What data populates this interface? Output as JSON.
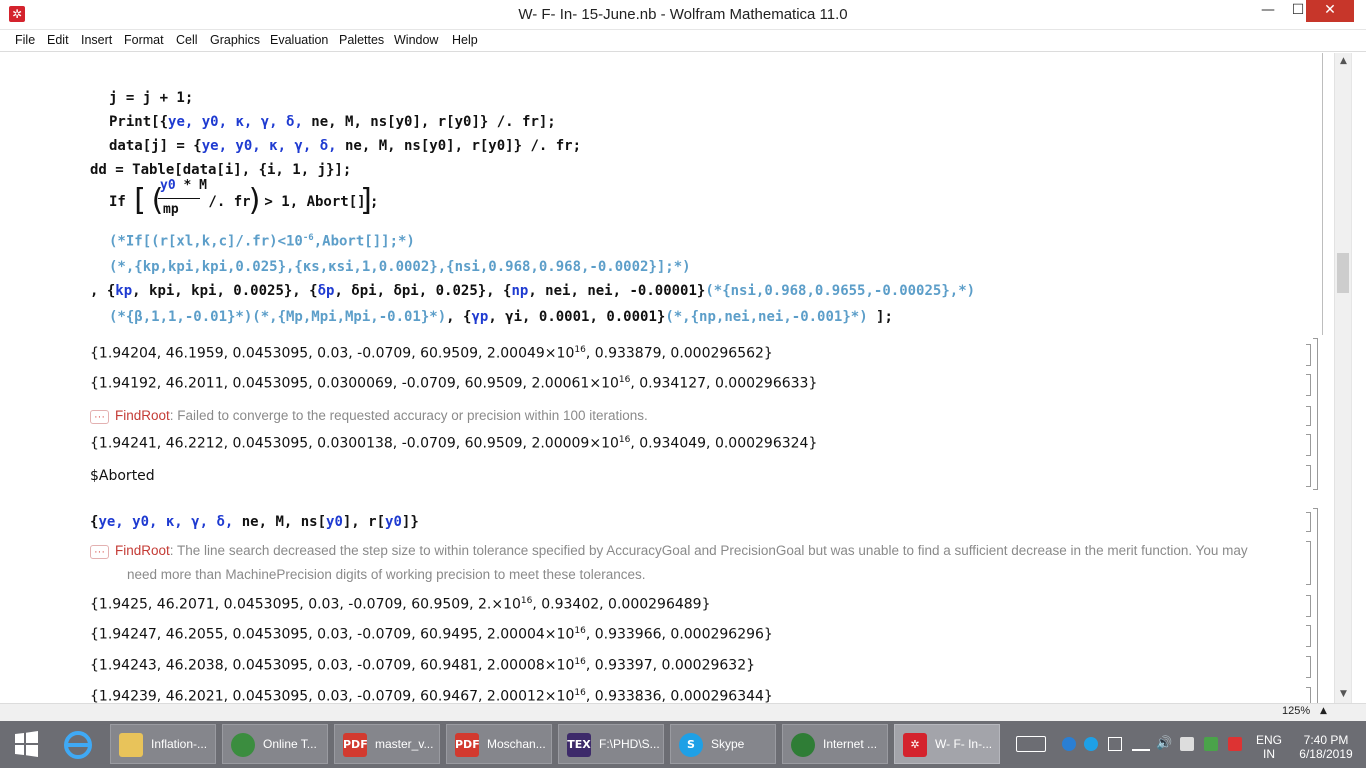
{
  "window": {
    "title": "W- F- In- 15-June.nb - Wolfram Mathematica 11.0",
    "minimize": "—",
    "maximize": "☐",
    "close": "✕"
  },
  "menu": [
    "File",
    "Edit",
    "Insert",
    "Format",
    "Cell",
    "Graphics",
    "Evaluation",
    "Palettes",
    "Window",
    "Help"
  ],
  "code": {
    "line1": "j = j + 1;",
    "line2_a": "Print[{",
    "line2_b": "ye, y0, κ, γ, δ,",
    "line2_c": " ne, M, ns[y0], r[y0]} /. fr];",
    "line3_a": "data[j] = {",
    "line3_b": "ye, y0, κ, γ, δ,",
    "line3_c": " ne, M, ns[y0], r[y0]} /. fr;",
    "line4": "dd = Table[data[i], {i, 1, j}];",
    "line5_if": "If",
    "line5_num": "y0 * M",
    "line5_den": "mp",
    "line5_rest": " /. fr",
    "line5_tail": " > 1, Abort[]",
    "line5_end": ";",
    "line6": "(*If[(r[xl,k,c]/.fr)<10",
    "line6_sup": "-6",
    "line6_tail": ",Abort[]];*)",
    "line7": "(*,{kp,kpi,kpi,0.025},{κs,κsi,1,0.0002},{nsi,0.968,0.968,-0.0002}];*)",
    "line8_a": ", {",
    "line8_b": "kp",
    "line8_c": ", kpi, kpi, 0.0025}, {",
    "line8_d": "δp",
    "line8_e": ", δpi, δpi, 0.025}, {",
    "line8_f": "np",
    "line8_g": ", nei, nei, -0.00001}",
    "line8_comment": "(*{nsi,0.968,0.9655,-0.00025},*)",
    "line9_comment": "(*{β,1,1,-0.01}*)(*,{Mp,Mpi,Mpi,-0.01}*)",
    "line9_b": ", {",
    "line9_c": "γp",
    "line9_d": ", γi, 0.0001, 0.0001}",
    "line9_comment2": "(*,{np,nei,nei,-0.001}*)",
    "line9_end": ";"
  },
  "outputs": [
    {
      "pre": "{1.94204, 46.1959, 0.0453095, 0.03, -0.0709, 60.9509, 2.00049×10",
      "sup": "16",
      "post": ", 0.933879, 0.000296562}"
    },
    {
      "pre": "{1.94192, 46.2011, 0.0453095, 0.0300069, -0.0709, 60.9509, 2.00061×10",
      "sup": "16",
      "post": ", 0.934127, 0.000296633}"
    },
    {
      "pre": "{1.94241, 46.2212, 0.0453095, 0.0300138, -0.0709, 60.9509, 2.00009×10",
      "sup": "16",
      "post": ", 0.934049, 0.000296324}"
    },
    {
      "pre": "{1.9425, 46.2071, 0.0453095, 0.03, -0.0709, 60.9509, 2.×10",
      "sup": "16",
      "post": ", 0.93402, 0.000296489}"
    },
    {
      "pre": "{1.94247, 46.2055, 0.0453095, 0.03, -0.0709, 60.9495, 2.00004×10",
      "sup": "16",
      "post": ", 0.933966, 0.000296296}"
    },
    {
      "pre": "{1.94243, 46.2038, 0.0453095, 0.03, -0.0709, 60.9481, 2.00008×10",
      "sup": "16",
      "post": ", 0.93397, 0.00029632}"
    },
    {
      "pre": "{1.94239, 46.2021, 0.0453095, 0.03, -0.0709, 60.9467, 2.00012×10",
      "sup": "16",
      "post": ", 0.933836, 0.000296344}"
    }
  ],
  "messages": {
    "dots": "···",
    "msg1_name": "FindRoot",
    "msg1_text": ": Failed to converge to the requested accuracy or precision within 100 iterations.",
    "msg2_name": "FindRoot",
    "msg2_text": ": The line search decreased the step size to within tolerance specified by AccuracyGoal and PrecisionGoal but was unable to find a sufficient decrease in the merit function. You may",
    "msg2_text2": "need more than MachinePrecision digits of working precision to meet these tolerances."
  },
  "aborted": "$Aborted",
  "input2": "{ye, y0, κ, γ, δ, ne, M, ns[y0], r[y0]}",
  "status": {
    "zoom": "125%"
  },
  "taskbar": {
    "tasks": [
      {
        "label": "Inflation-...",
        "icon": "folder-icon",
        "color": "#e8c35a"
      },
      {
        "label": "Online T...",
        "icon": "chrome-icon",
        "color": "#3b8d3f"
      },
      {
        "label": "master_v...",
        "icon": "pdf-icon",
        "color": "#d23a2f"
      },
      {
        "label": "Moschan...",
        "icon": "pdf-icon",
        "color": "#d23a2f"
      },
      {
        "label": "F:\\PHD\\S...",
        "icon": "tex-icon",
        "color": "#3d2a6a"
      },
      {
        "label": "Skype",
        "icon": "skype-icon",
        "color": "#1ea0e6"
      },
      {
        "label": "Internet ...",
        "icon": "globe-icon",
        "color": "#2f7d36"
      },
      {
        "label": "W- F- In-...",
        "icon": "mathematica-icon",
        "color": "#d4232d"
      }
    ],
    "lang_top": "ENG",
    "lang_bottom": "IN",
    "time": "7:40 PM",
    "date": "6/18/2019"
  }
}
